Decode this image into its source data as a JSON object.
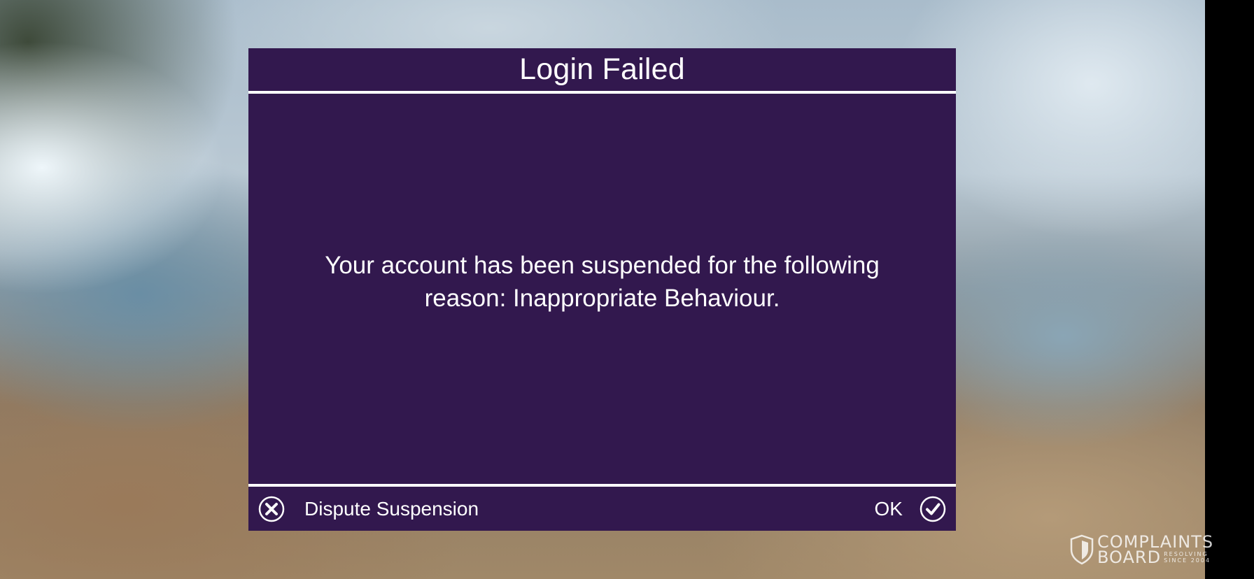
{
  "dialog": {
    "title": "Login Failed",
    "message": "Your account has been suspended for the following reason: Inappropriate Behaviour.",
    "dispute_label": "Dispute Suspension",
    "ok_label": "OK"
  },
  "watermark": {
    "line1": "COMPLAINTS",
    "line2": "BOARD",
    "tag1": "RESOLVING",
    "tag2": "SINCE 2004"
  },
  "icons": {
    "dispute": "close-circle-icon",
    "ok": "check-circle-icon",
    "watermark": "shield-icon"
  },
  "colors": {
    "dialog_background": "#32184e",
    "text": "#ffffff",
    "divider": "#ffffff"
  }
}
